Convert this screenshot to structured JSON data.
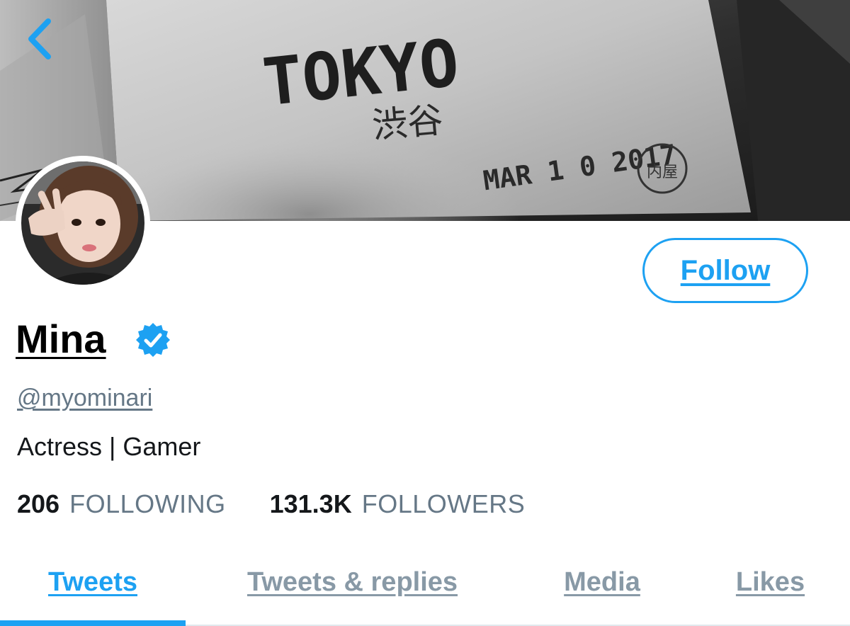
{
  "header": {
    "banner_text": {
      "city": "TOKYO",
      "district": "渋谷",
      "date_stamp": "MAR 1 0 2017",
      "seal": "内屋"
    }
  },
  "profile": {
    "display_name": "Mina",
    "verified": true,
    "handle": "@myominari",
    "bio": "Actress | Gamer",
    "follow_label": "Follow"
  },
  "stats": {
    "following_count": "206",
    "following_label": "FOLLOWING",
    "followers_count": "131.3K",
    "followers_label": "FOLLOWERS"
  },
  "tabs": [
    {
      "label": "Tweets",
      "active": true
    },
    {
      "label": "Tweets & replies",
      "active": false
    },
    {
      "label": "Media",
      "active": false
    },
    {
      "label": "Likes",
      "active": false
    }
  ],
  "icons": {
    "back": "chevron-left-icon",
    "verified": "verified-badge-icon"
  },
  "colors": {
    "accent": "#1da1f2",
    "secondary_text": "#657786",
    "tab_inactive": "#8899a6",
    "primary_text": "#14171a"
  }
}
